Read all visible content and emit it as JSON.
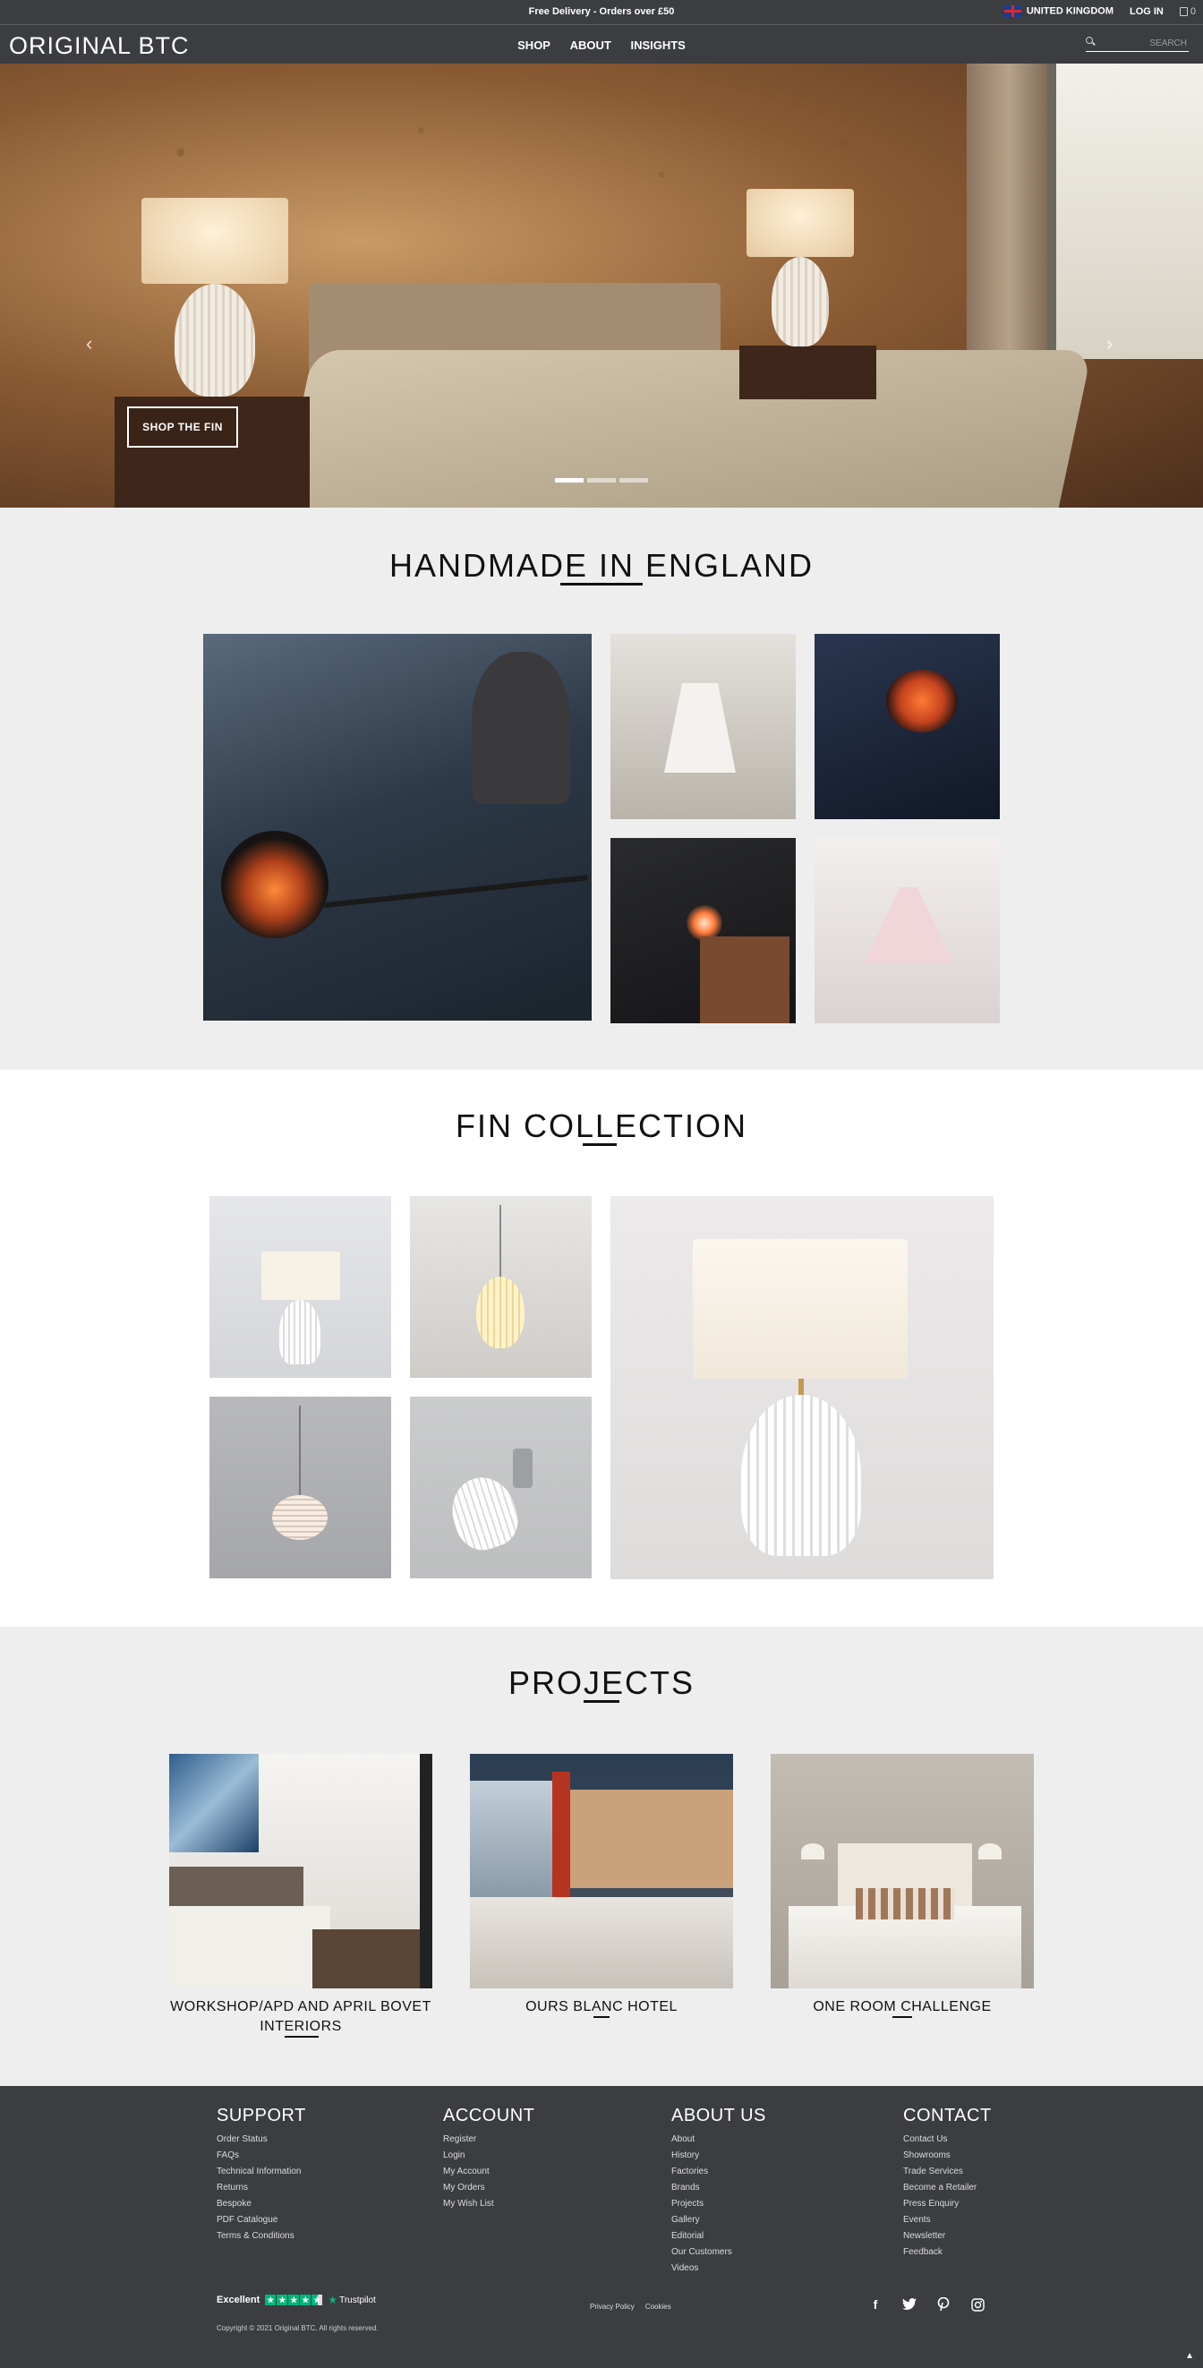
{
  "topbar": {
    "promo": "Free Delivery - Orders over £50",
    "region": "UNITED KINGDOM",
    "login": "LOG IN",
    "cart_count": "0"
  },
  "nav": {
    "logo": "ORIGINAL BTC",
    "links": [
      "SHOP",
      "ABOUT",
      "INSIGHTS"
    ],
    "search_placeholder": "SEARCH"
  },
  "hero": {
    "cta": "SHOP THE FIN",
    "slides": 3,
    "active_slide": 1
  },
  "handmade": {
    "title": "HANDMADE IN ENGLAND"
  },
  "fin": {
    "title": "FIN COLLECTION"
  },
  "projects": {
    "title": "PROJECTS",
    "items": [
      {
        "caption": "WORKSHOP/APD AND APRIL BOVET INTERIORS"
      },
      {
        "caption": "OURS BLANC HOTEL"
      },
      {
        "caption": "ONE ROOM CHALLENGE"
      }
    ]
  },
  "footer": {
    "support": {
      "title": "SUPPORT",
      "links": [
        "Order Status",
        "FAQs",
        "Technical Information",
        "Returns",
        "Bespoke",
        "PDF Catalogue",
        "Terms & Conditions"
      ]
    },
    "account": {
      "title": "ACCOUNT",
      "links": [
        "Register",
        "Login",
        "My Account",
        "My Orders",
        "My Wish List"
      ]
    },
    "about": {
      "title": "ABOUT US",
      "links": [
        "About",
        "History",
        "Factories",
        "Brands",
        "Projects",
        "Gallery",
        "Editorial",
        "Our Customers",
        "Videos"
      ]
    },
    "contact": {
      "title": "CONTACT",
      "links": [
        "Contact Us",
        "Showrooms",
        "Trade Services",
        "Become a Retailer",
        "Press Enquiry",
        "Events",
        "Newsletter",
        "Feedback"
      ]
    },
    "trustpilot": {
      "rating_label": "Excellent",
      "brand": "Trustpilot"
    },
    "legal": [
      "Privacy Policy",
      "Cookies"
    ],
    "copyright": "Copyright © 2021 Original BTC. All rights reserved.",
    "social_icons": [
      "facebook-icon",
      "twitter-icon",
      "pinterest-icon",
      "instagram-icon"
    ]
  },
  "colors": {
    "header_bg": "#3b3d40",
    "section_alt_bg": "#eeeeee",
    "trustpilot_green": "#00b67a"
  }
}
